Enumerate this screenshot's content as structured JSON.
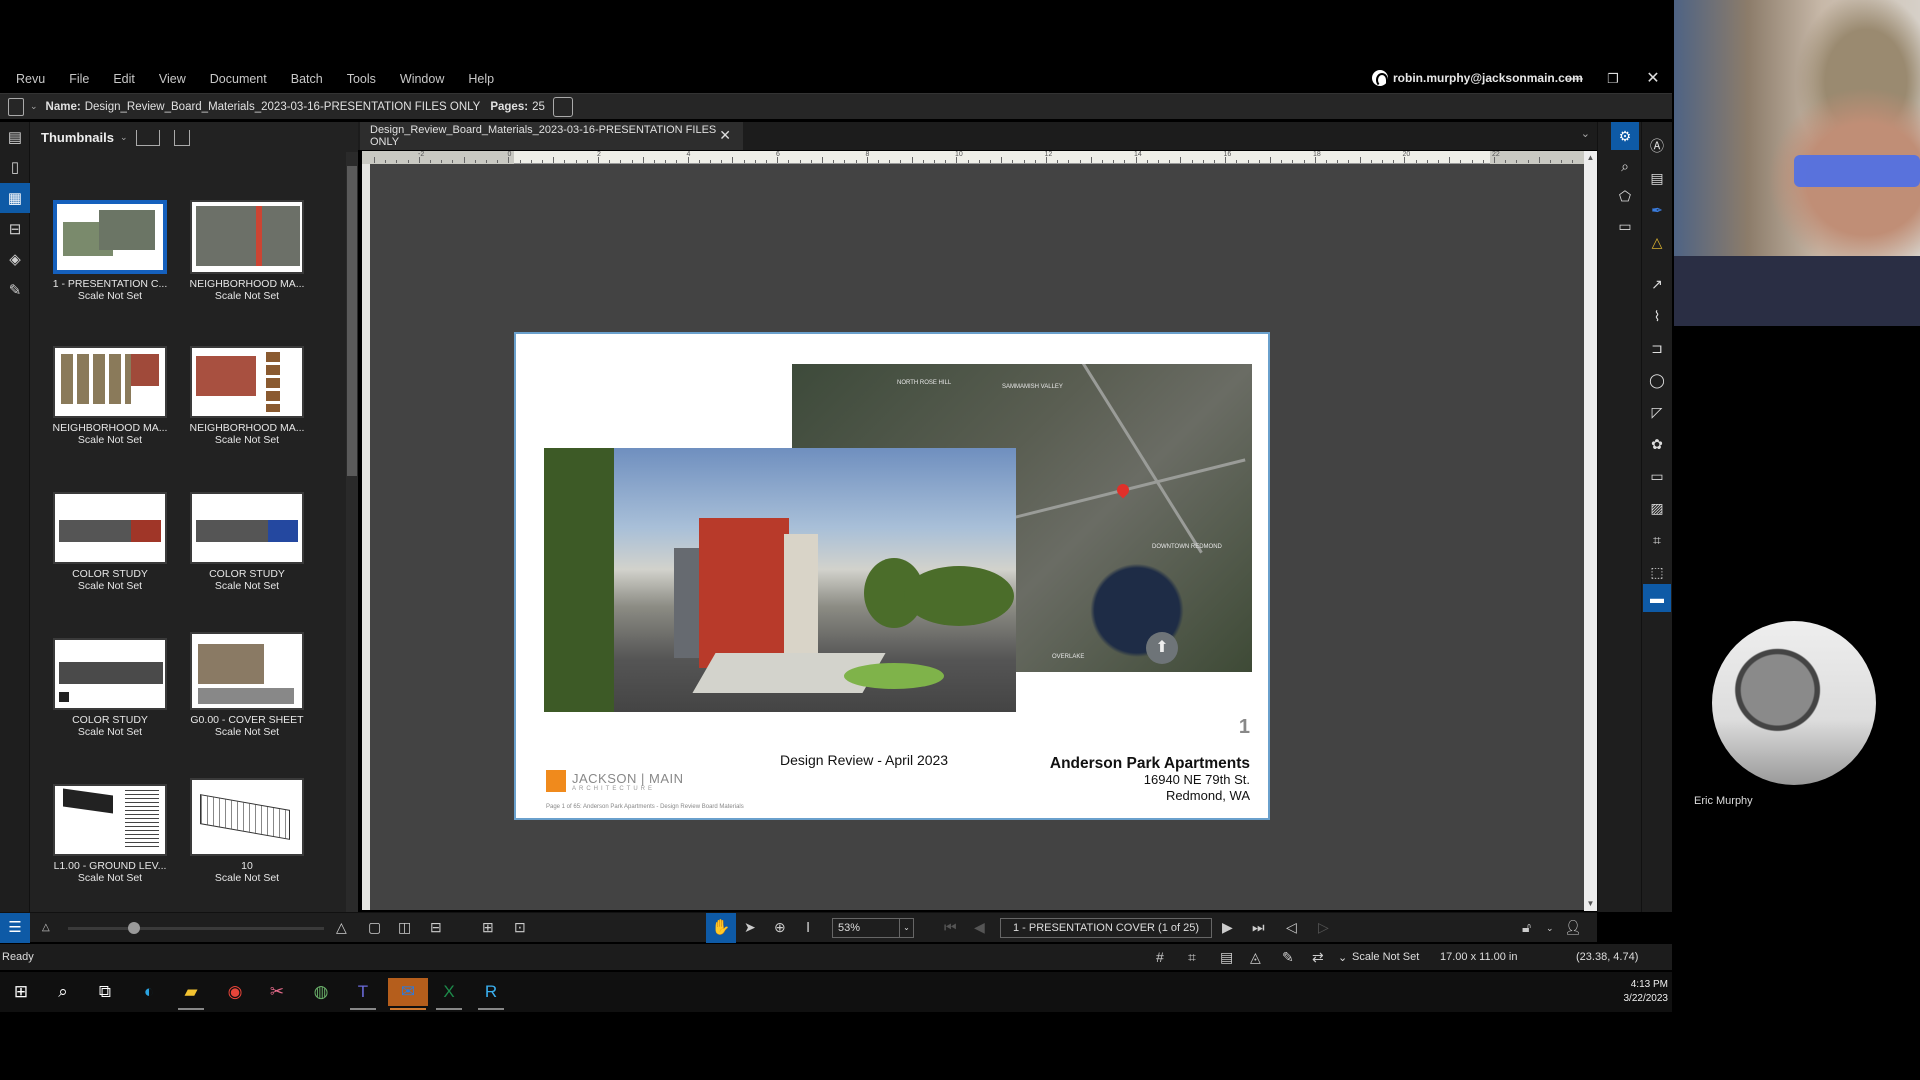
{
  "menu": [
    "Revu",
    "File",
    "Edit",
    "View",
    "Document",
    "Batch",
    "Tools",
    "Window",
    "Help"
  ],
  "account": {
    "email": "robin.murphy@jacksonmain.com"
  },
  "window_controls": {
    "minimize": "—",
    "restore": "❐",
    "close": "✕"
  },
  "namebar": {
    "name_label": "Name:",
    "name": "Design_Review_Board_Materials_2023-03-16-PRESENTATION FILES ONLY",
    "pages_label": "Pages:",
    "pages": "25"
  },
  "left_rail": [
    "file-access-icon",
    "bookmarks-icon",
    "thumbnails-icon",
    "toolchest-icon",
    "layers-icon",
    "signatures-icon"
  ],
  "thumbnails": {
    "title": "Thumbnails",
    "items": [
      {
        "label": "1 - PRESENTATION C...",
        "scale": "Scale Not Set",
        "selected": true
      },
      {
        "label": "NEIGHBORHOOD MA...",
        "scale": "Scale Not Set"
      },
      {
        "label": "NEIGHBORHOOD MA...",
        "scale": "Scale Not Set"
      },
      {
        "label": "NEIGHBORHOOD MA...",
        "scale": "Scale Not Set"
      },
      {
        "label": "COLOR STUDY",
        "scale": "Scale Not Set"
      },
      {
        "label": "COLOR STUDY",
        "scale": "Scale Not Set"
      },
      {
        "label": "COLOR STUDY",
        "scale": "Scale Not Set"
      },
      {
        "label": "G0.00 - COVER SHEET",
        "scale": "Scale Not Set"
      },
      {
        "label": "L1.00 - GROUND LEV...",
        "scale": "Scale Not Set"
      },
      {
        "label": "10",
        "scale": "Scale Not Set"
      }
    ]
  },
  "doc_tab": {
    "title": "Design_Review_Board_Materials_2023-03-16-PRESENTATION FILES ONLY",
    "close": "✕"
  },
  "ruler_ticks": [
    "-2",
    "0",
    "2",
    "4",
    "6",
    "8",
    "10",
    "12",
    "14",
    "16",
    "18",
    "20",
    "22"
  ],
  "page": {
    "number": "1",
    "subtitle": "Design Review - April 2023",
    "project": "Anderson Park Apartments",
    "address1": "16940 NE 79th  St.",
    "address2": "Redmond, WA",
    "firm_name": "JACKSON | MAIN",
    "firm_sub": "ARCHITECTURE",
    "footer": "Page 1 of 65: Anderson Park Apartments - Design Review Board Materials",
    "map_labels": [
      "NORTH ROSE HILL",
      "SAMMAMISH VALLEY",
      "DOWNTOWN REDMOND",
      "OVERLAKE"
    ]
  },
  "bottom_toolbar": {
    "zoom": "53%",
    "page_selector": "1 - PRESENTATION COVER (1 of 25)"
  },
  "status": {
    "ready": "Ready",
    "scale": "Scale Not Set",
    "size": "17.00 x 11.00 in",
    "coords": "(23.38, 4.74)"
  },
  "taskbar": [
    "start",
    "search",
    "task-view",
    "edge",
    "file-explorer",
    "chrome",
    "snipping-tool",
    "maps",
    "teams",
    "outlook",
    "excel",
    "bluebeam-revu"
  ],
  "clock": {
    "time": "4:13 PM",
    "date": "3/22/2023"
  },
  "participant": {
    "name": "Eric Murphy"
  }
}
